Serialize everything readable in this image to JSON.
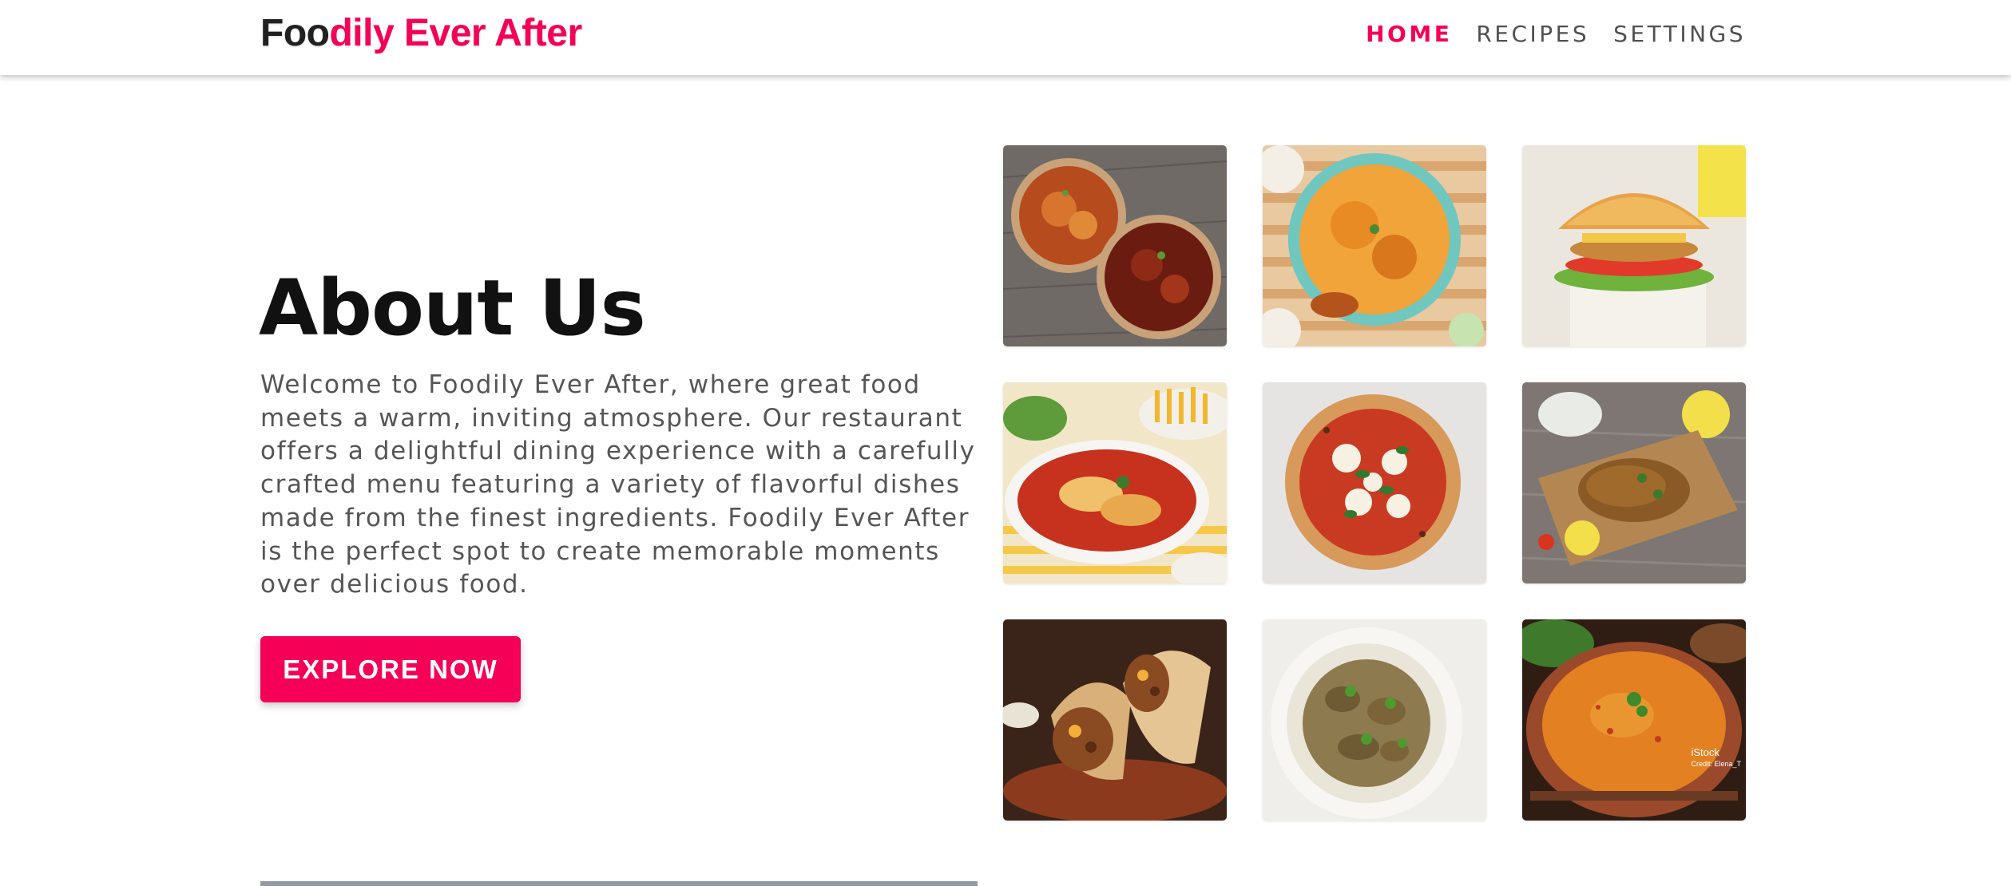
{
  "header": {
    "brand_part1": "Foo",
    "brand_part2": "dily Ever After",
    "nav": [
      {
        "label": "HOME",
        "active": true
      },
      {
        "label": "RECIPES",
        "active": false
      },
      {
        "label": "SETTINGS",
        "active": false
      }
    ]
  },
  "about": {
    "title": "About Us",
    "text": "Welcome to Foodily Ever After, where great food meets a warm, inviting atmosphere. Our restaurant offers a delightful dining experience with a carefully crafted menu featuring a variety of flavorful dishes made from the finest ingredients. Foodily Ever After is the perfect spot to create memorable moments over delicious food.",
    "button_label": "EXPLORE NOW"
  },
  "gallery": {
    "watermark_brand": "iStock",
    "watermark_credit": "Credit: Elena_T",
    "images": [
      {
        "icon": "noodle-bowls-image"
      },
      {
        "icon": "biryani-plate-image"
      },
      {
        "icon": "burger-image"
      },
      {
        "icon": "baked-pasta-image"
      },
      {
        "icon": "margherita-pizza-image"
      },
      {
        "icon": "fried-cutlet-image"
      },
      {
        "icon": "burrito-image"
      },
      {
        "icon": "chicken-curry-image"
      },
      {
        "icon": "lentil-soup-image"
      }
    ]
  },
  "colors": {
    "accent": "#f50057",
    "text_dark": "#111111",
    "text_muted": "#555555",
    "nav_text": "#505050"
  }
}
